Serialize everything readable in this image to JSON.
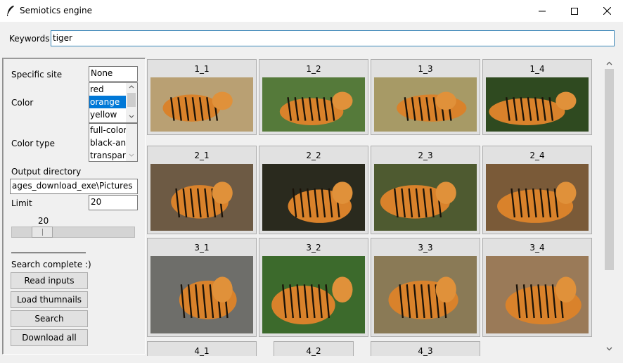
{
  "window": {
    "title": "Semiotics engine"
  },
  "keywords": {
    "label": "Keywords",
    "value": "tiger"
  },
  "form": {
    "specific_site_label": "Specific site",
    "specific_site_value": "None",
    "color_label": "Color",
    "color_options": [
      "red",
      "orange",
      "yellow"
    ],
    "color_selected": "orange",
    "color_type_label": "Color type",
    "color_type_options": [
      "full-color",
      "black-and-white",
      "transparent"
    ],
    "output_dir_label": "Output directory",
    "output_dir_value": "ages_download_exe\\Pictures",
    "limit_label": "Limit",
    "limit_value": "20",
    "slider_value": "20",
    "slider_fraction": 0.2,
    "status": "Search complete :)"
  },
  "buttons": {
    "read_inputs": "Read inputs",
    "load_thumbnails": "Load thumnails",
    "search": "Search",
    "download_all": "Download all"
  },
  "thumbnails": [
    {
      "label": "1_1"
    },
    {
      "label": "1_2"
    },
    {
      "label": "1_3"
    },
    {
      "label": "1_4"
    },
    {
      "label": "2_1"
    },
    {
      "label": "2_2"
    },
    {
      "label": "2_3"
    },
    {
      "label": "2_4"
    },
    {
      "label": "3_1"
    },
    {
      "label": "3_2"
    },
    {
      "label": "3_3"
    },
    {
      "label": "3_4"
    },
    {
      "label": "4_1"
    },
    {
      "label": "4_2"
    },
    {
      "label": "4_3"
    }
  ],
  "icons": {
    "app": "feather-icon",
    "minimize": "minimize-icon",
    "maximize": "maximize-icon",
    "close": "close-icon"
  },
  "colors": {
    "selection": "#0078d7",
    "focus_border": "#3b86b8",
    "tiger_orange": "#d9822b"
  }
}
